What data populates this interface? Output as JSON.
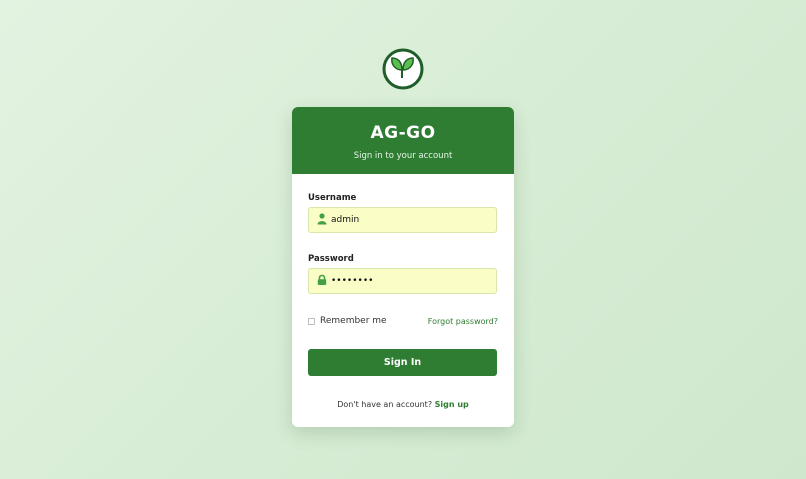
{
  "brand": {
    "logo_icon": "sprout-icon",
    "title": "AG-GO",
    "subtitle": "Sign in to your account",
    "primary_color": "#2e7d32"
  },
  "form": {
    "username_label": "Username",
    "username_value": "admin",
    "username_icon": "user-icon",
    "password_label": "Password",
    "password_value": "••••••••",
    "password_icon": "lock-icon",
    "remember_label": "Remember me",
    "forgot_label": "Forgot password?",
    "submit_label": "Sign In"
  },
  "footer": {
    "prompt": "Don't have an account?",
    "signup_label": "Sign up"
  }
}
